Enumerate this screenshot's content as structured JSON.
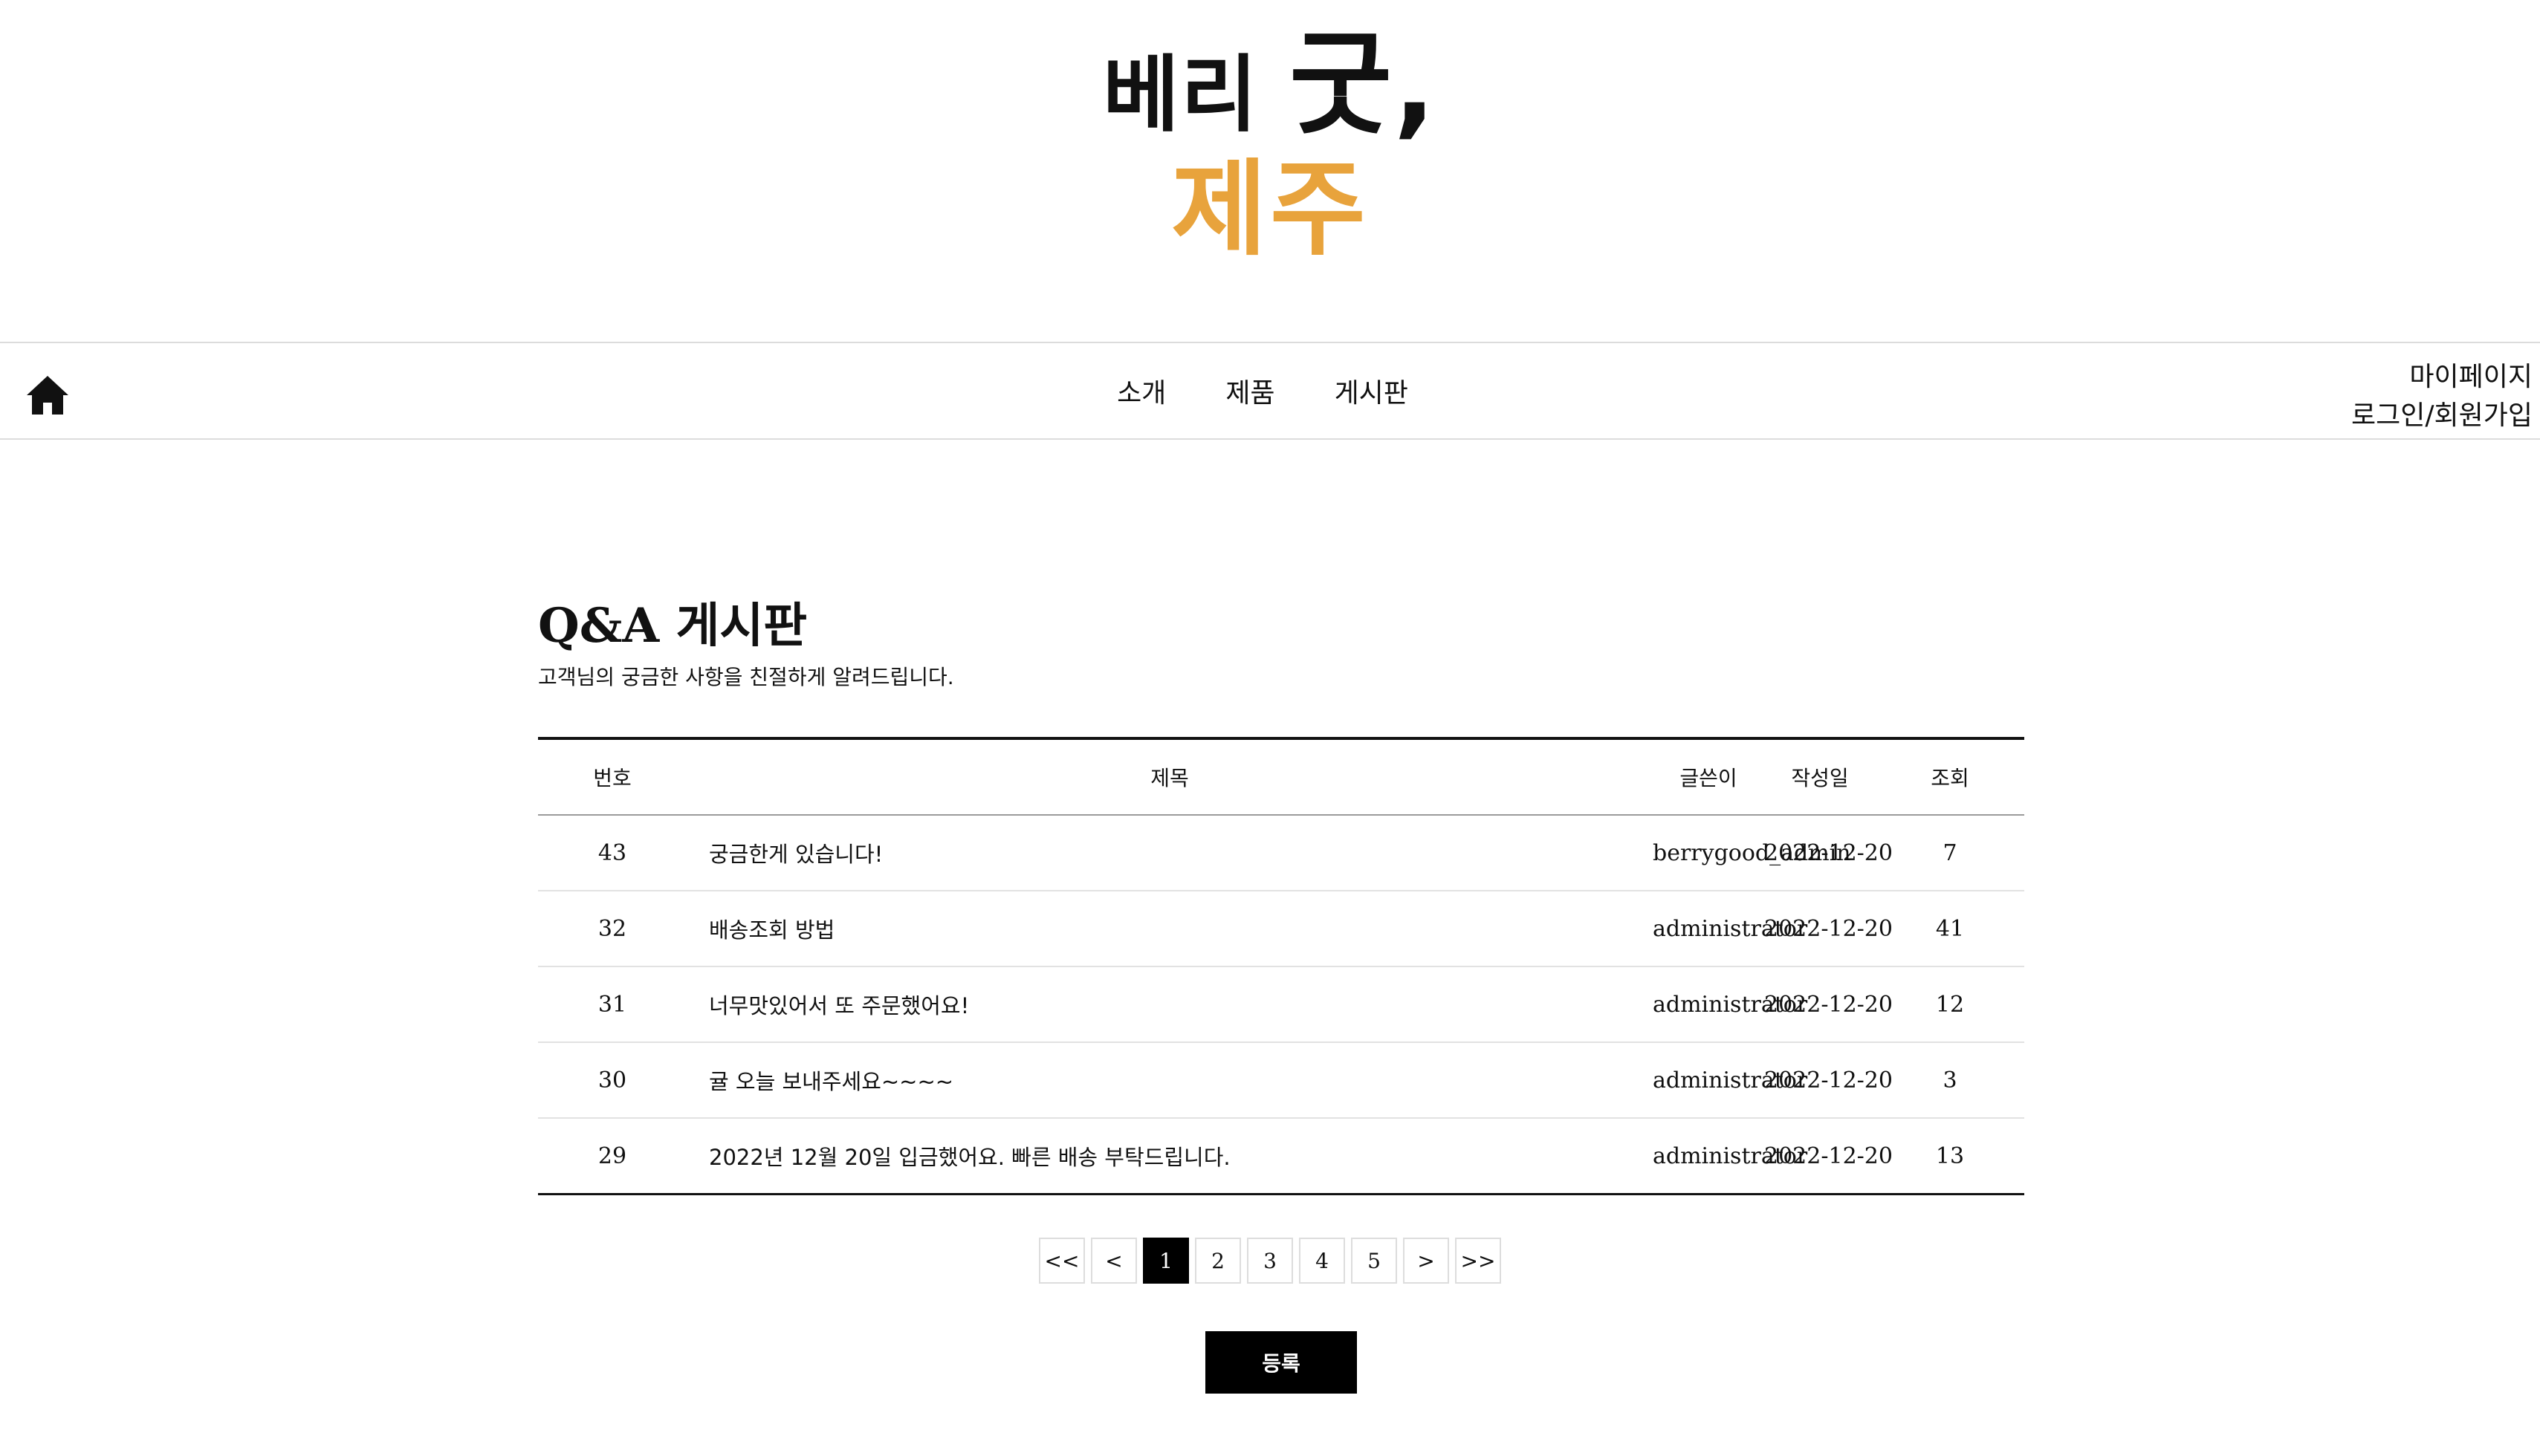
{
  "logo": {
    "line1_part1": "베리",
    "line1_part2": "굿,",
    "line2": "제주",
    "accent_color": "#e8a33c"
  },
  "nav": {
    "home_icon": "home-icon",
    "menu": [
      "소개",
      "제품",
      "게시판"
    ],
    "mypage": "마이페이지",
    "login_signup": "로그인/회원가입"
  },
  "board": {
    "title": "Q&A 게시판",
    "subtitle": "고객님의 궁금한 사항을 친절하게 알려드립니다.",
    "columns": [
      "번호",
      "제목",
      "글쓴이",
      "작성일",
      "조회"
    ],
    "rows": [
      {
        "no": "43",
        "title": "궁금한게 있습니다!",
        "writer": "berrygood_admin",
        "date": "2022-12-20",
        "views": "7"
      },
      {
        "no": "32",
        "title": "배송조회 방법",
        "writer": "administrator",
        "date": "2022-12-20",
        "views": "41"
      },
      {
        "no": "31",
        "title": "너무맛있어서 또 주문했어요!",
        "writer": "administrator",
        "date": "2022-12-20",
        "views": "12"
      },
      {
        "no": "30",
        "title": "귤 오늘 보내주세요~~~~",
        "writer": "administrator",
        "date": "2022-12-20",
        "views": "3"
      },
      {
        "no": "29",
        "title": "2022년 12월 20일 입금했어요. 빠른 배송 부탁드립니다.",
        "writer": "administrator",
        "date": "2022-12-20",
        "views": "13"
      }
    ]
  },
  "pagination": {
    "first": "<<",
    "prev": "<",
    "pages": [
      "1",
      "2",
      "3",
      "4",
      "5"
    ],
    "current": "1",
    "next": ">",
    "last": ">>"
  },
  "actions": {
    "register": "등록"
  }
}
